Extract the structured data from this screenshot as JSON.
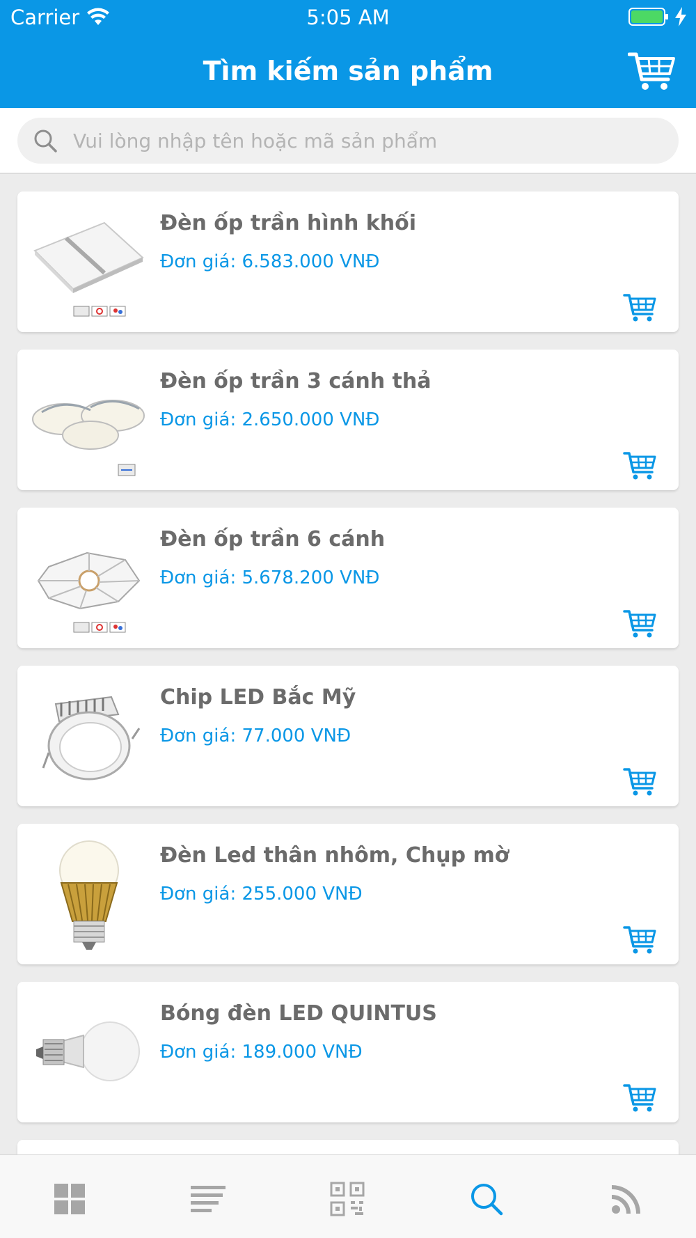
{
  "status_bar": {
    "carrier": "Carrier",
    "time": "5:05 AM"
  },
  "header": {
    "title": "Tìm kiếm sản phẩm",
    "cart_icon": "cart-icon"
  },
  "search": {
    "placeholder": "Vui lòng nhập tên hoặc mã sản phẩm",
    "value": ""
  },
  "products": [
    {
      "name": "Đèn ốp trần hình khối",
      "price": "Đơn giá: 6.583.000 VNĐ",
      "image": "square-ceiling-light"
    },
    {
      "name": "Đèn ốp trần 3 cánh thả",
      "price": "Đơn giá: 2.650.000 VNĐ",
      "image": "three-petal-ceiling-light"
    },
    {
      "name": "Đèn ốp trần 6 cánh",
      "price": "Đơn giá: 5.678.200 VNĐ",
      "image": "six-petal-ceiling-light"
    },
    {
      "name": "Chip LED Bắc Mỹ",
      "price": "Đơn giá: 77.000 VNĐ",
      "image": "led-downlight"
    },
    {
      "name": "Đèn Led thân nhôm, Chụp mờ",
      "price": "Đơn giá: 255.000 VNĐ",
      "image": "aluminum-led-bulb"
    },
    {
      "name": "Bóng đèn LED QUINTUS",
      "price": "Đơn giá: 189.000 VNĐ",
      "image": "led-bulb"
    }
  ],
  "tabbar": {
    "active_index": 3,
    "tabs": [
      "dashboard-icon",
      "list-icon",
      "qr-code-icon",
      "search-icon",
      "rss-icon"
    ]
  },
  "colors": {
    "accent": "#0a97e6",
    "tab_inactive": "#a6a6a6",
    "title_text": "#6b6b6b"
  }
}
